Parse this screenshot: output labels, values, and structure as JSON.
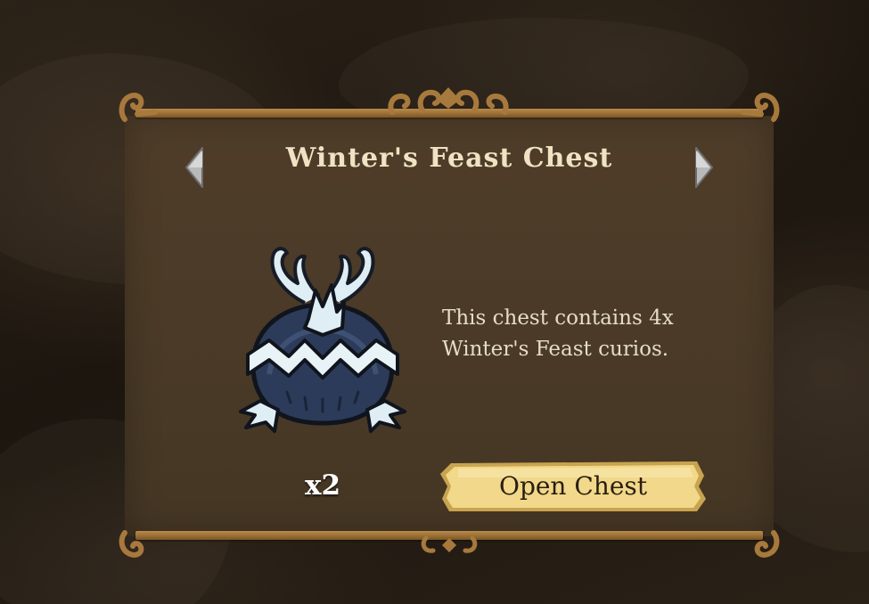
{
  "dialog": {
    "title": "Winter's Feast Chest",
    "description_line1": "This chest contains 4x",
    "description_line2": "Winter's Feast curios.",
    "quantity": "x2",
    "open_button_label": "Open Chest"
  },
  "icons": {
    "previous": "chevron-left-icon",
    "next": "chevron-right-icon",
    "item": "winters-feast-chest-icon"
  },
  "colors": {
    "panel": "#4a3a27",
    "trim": "#9a6f36",
    "title_text": "#efe3c4",
    "button_fill": "#f1d88a",
    "chest_ice": "#dfeef4",
    "chest_body": "#2c3b59"
  }
}
